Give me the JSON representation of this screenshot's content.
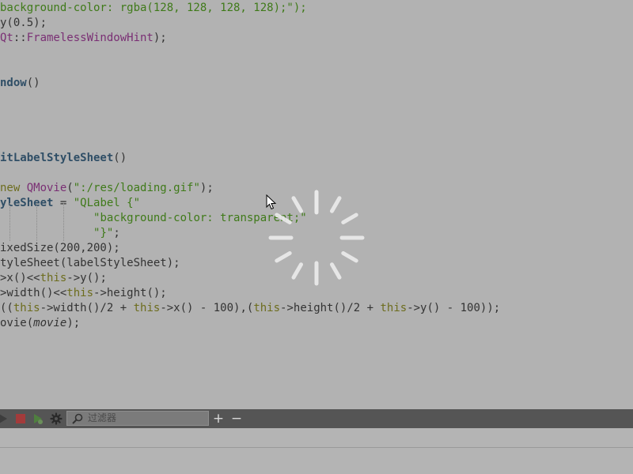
{
  "editor": {
    "lines": [
      {
        "segments": [
          {
            "text": "background-color: rgba(128, 128, 128, 128);\");",
            "cls": "str"
          }
        ]
      },
      {
        "segments": [
          {
            "text": "y(0.5);",
            "cls": ""
          }
        ]
      },
      {
        "segments": [
          {
            "text": "Qt",
            "cls": "ty"
          },
          {
            "text": "::",
            "cls": ""
          },
          {
            "text": "FramelessWindowHint",
            "cls": "ty"
          },
          {
            "text": ");",
            "cls": ""
          }
        ]
      },
      {
        "segments": [
          {
            "text": "ndow",
            "cls": "fn"
          },
          {
            "text": "()",
            "cls": ""
          }
        ]
      },
      {
        "segments": [
          {
            "text": "itLabelStyleSheet",
            "cls": "fn"
          },
          {
            "text": "()",
            "cls": ""
          }
        ]
      },
      {
        "segments": [
          {
            "text": "new ",
            "cls": "kw"
          },
          {
            "text": "QMovie",
            "cls": "ty"
          },
          {
            "text": "(",
            "cls": ""
          },
          {
            "text": "\":/res/loading.gif\"",
            "cls": "str"
          },
          {
            "text": ");",
            "cls": ""
          }
        ]
      },
      {
        "segments": [
          {
            "text": "yleSheet",
            "cls": "fn"
          },
          {
            "text": " = ",
            "cls": ""
          },
          {
            "text": "\"QLabel {\"",
            "cls": "str"
          }
        ]
      },
      {
        "segments": [
          {
            "text": "              ",
            "cls": ""
          },
          {
            "text": "\"background-color: transparent;\"",
            "cls": "str"
          }
        ]
      },
      {
        "segments": [
          {
            "text": "              ",
            "cls": ""
          },
          {
            "text": "\"}\"",
            "cls": "str"
          },
          {
            "text": ";",
            "cls": ""
          }
        ]
      },
      {
        "segments": [
          {
            "text": "ixedSize(200,200);",
            "cls": ""
          }
        ]
      },
      {
        "segments": [
          {
            "text": "tyleSheet(labelStyleSheet);",
            "cls": ""
          }
        ]
      },
      {
        "segments": [
          {
            "text": ">x()<<",
            "cls": ""
          },
          {
            "text": "this",
            "cls": "kw"
          },
          {
            "text": "->y();",
            "cls": ""
          }
        ]
      },
      {
        "segments": [
          {
            "text": ">width()<<",
            "cls": ""
          },
          {
            "text": "this",
            "cls": "kw"
          },
          {
            "text": "->height();",
            "cls": ""
          }
        ]
      },
      {
        "segments": [
          {
            "text": "((",
            "cls": ""
          },
          {
            "text": "this",
            "cls": "kw"
          },
          {
            "text": "->width()/2 + ",
            "cls": ""
          },
          {
            "text": "this",
            "cls": "kw"
          },
          {
            "text": "->x() - 100),(",
            "cls": ""
          },
          {
            "text": "this",
            "cls": "kw"
          },
          {
            "text": "->height()/2 + ",
            "cls": ""
          },
          {
            "text": "this",
            "cls": "kw"
          },
          {
            "text": "->y() - 100));",
            "cls": ""
          }
        ]
      },
      {
        "segments": [
          {
            "text": "ovie(",
            "cls": ""
          },
          {
            "text": "movie",
            "cls": "it"
          },
          {
            "text": ");",
            "cls": ""
          }
        ]
      }
    ]
  },
  "toolbar": {
    "filter_placeholder": "过滤器",
    "add_label": "+",
    "remove_label": "−"
  },
  "colors": {
    "string": "#3f7a19",
    "keyword": "#6d6d1e",
    "type": "#7a2f74",
    "function": "#2f4e66",
    "toolbar_bg": "#555555"
  },
  "icons": [
    "play-icon",
    "stop-icon",
    "run-debug-icon",
    "gear-icon",
    "search-icon",
    "spinner-icon",
    "mouse-cursor-icon"
  ]
}
